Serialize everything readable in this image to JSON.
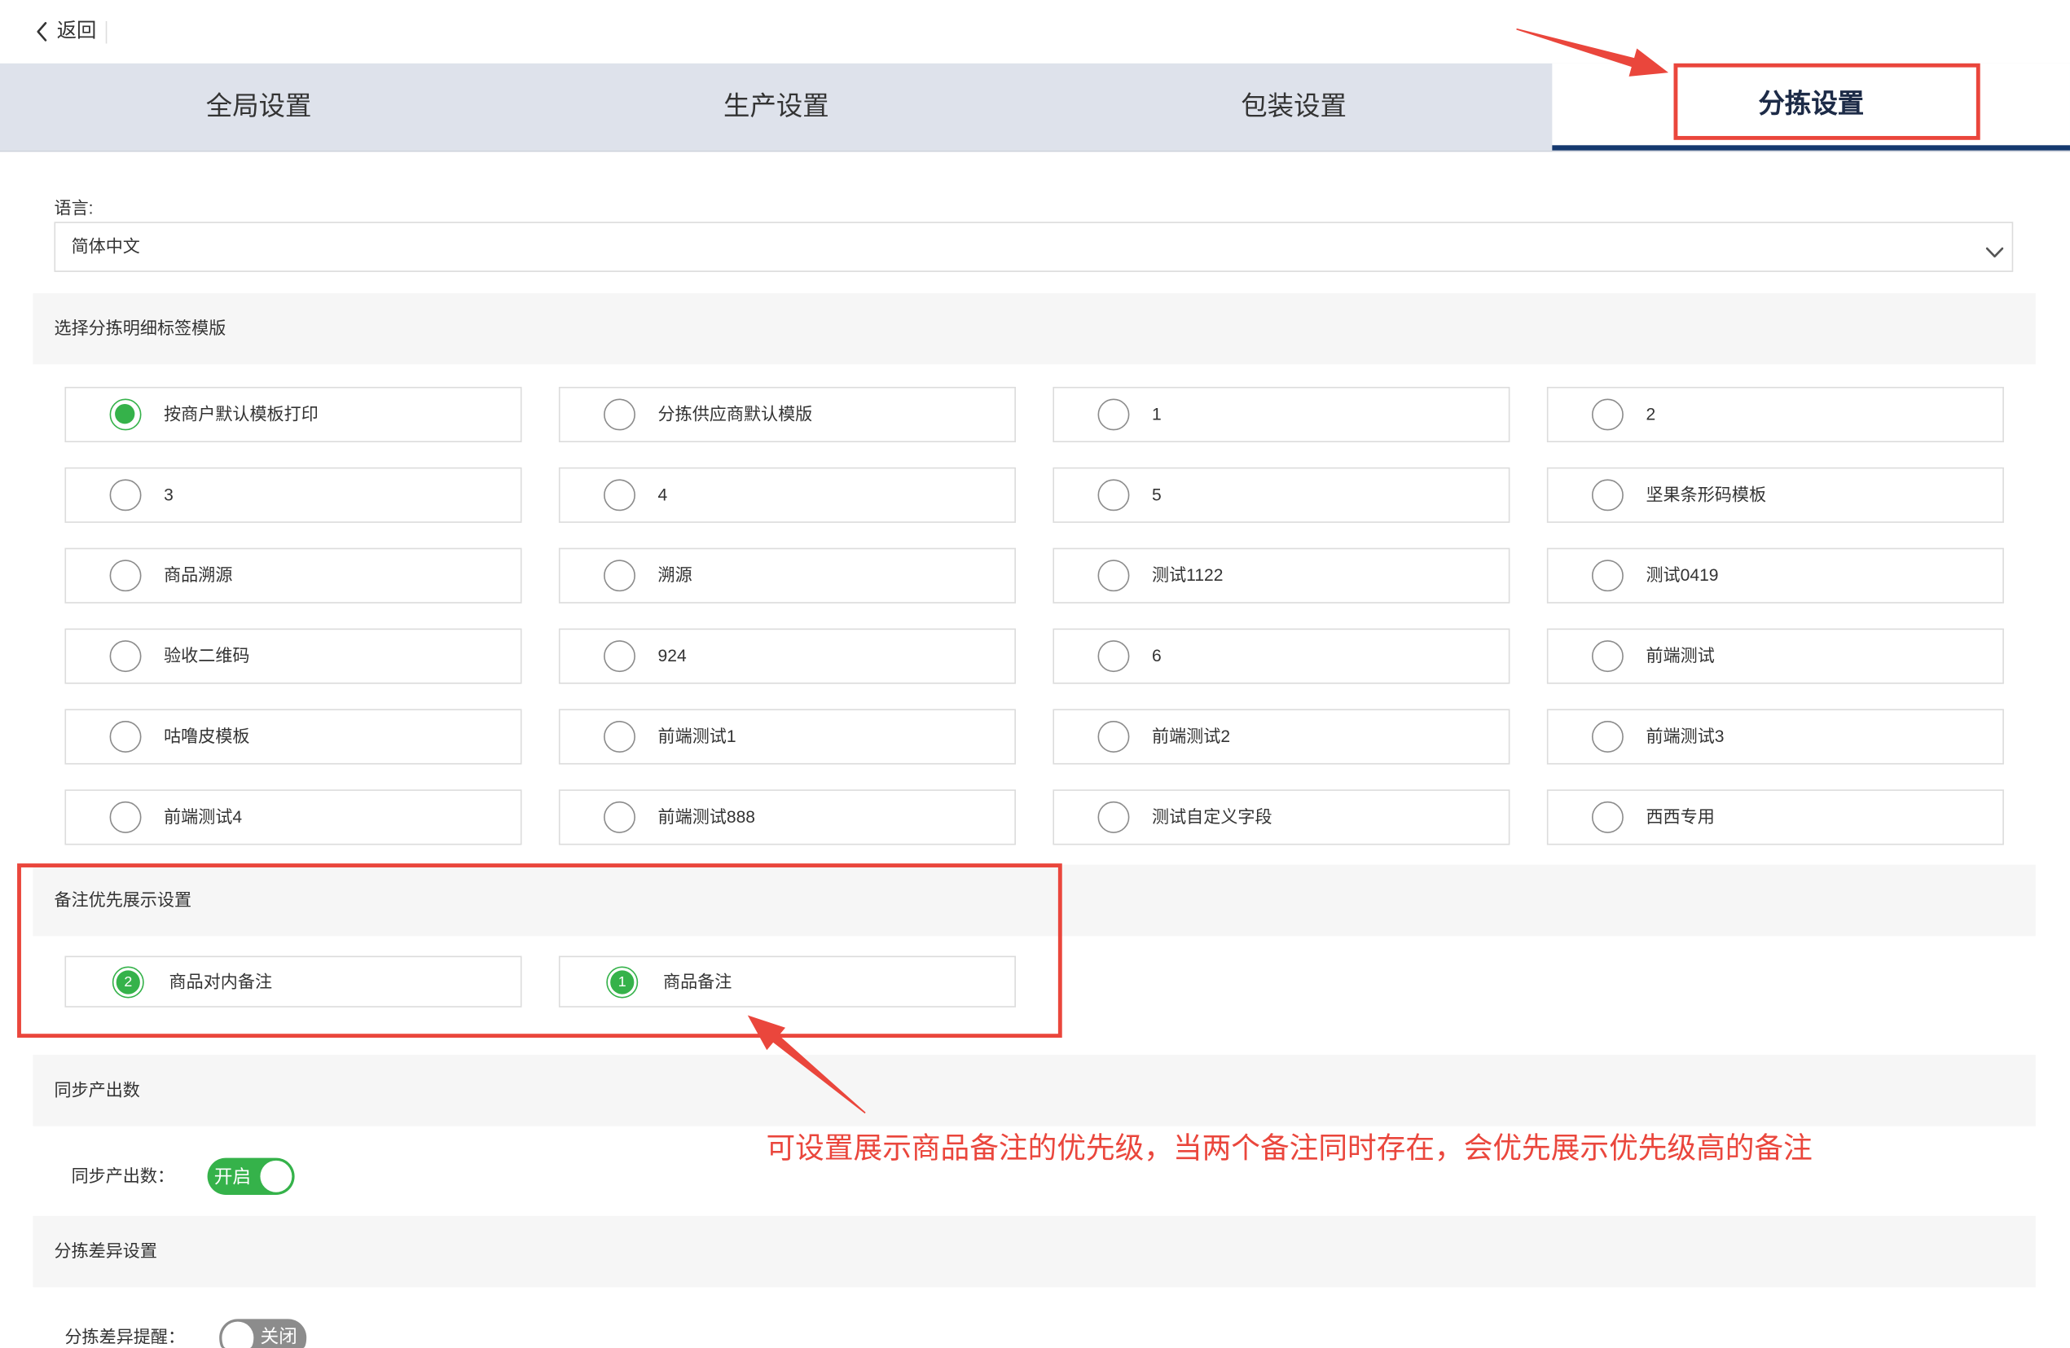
{
  "header": {
    "back_label": "返回"
  },
  "tabs": [
    {
      "label": "全局设置",
      "active": false
    },
    {
      "label": "生产设置",
      "active": false
    },
    {
      "label": "包装设置",
      "active": false
    },
    {
      "label": "分拣设置",
      "active": true
    }
  ],
  "language": {
    "label": "语言:",
    "value": "简体中文"
  },
  "template_section": {
    "title": "选择分拣明细标签模版",
    "selected_index": 0,
    "options": [
      "按商户默认模板打印",
      "分拣供应商默认模版",
      "1",
      "2",
      "3",
      "4",
      "5",
      "坚果条形码模板",
      "商品溯源",
      "溯源",
      "测试1122",
      "测试0419",
      "验收二维码",
      "924",
      "6",
      "前端测试",
      "咕噜皮模板",
      "前端测试1",
      "前端测试2",
      "前端测试3",
      "前端测试4",
      "前端测试888",
      "测试自定义字段",
      "西西专用"
    ]
  },
  "remark_section": {
    "title": "备注优先展示设置",
    "items": [
      {
        "label": "商品对内备注",
        "priority": "2"
      },
      {
        "label": "商品备注",
        "priority": "1"
      }
    ]
  },
  "sync_section": {
    "title": "同步产出数",
    "field_label": "同步产出数：",
    "toggle_label": "开启",
    "enabled": true
  },
  "diff_section": {
    "title": "分拣差异设置",
    "field_label": "分拣差异提醒：",
    "toggle_label": "关闭",
    "enabled": false
  },
  "annotation": {
    "text": "可设置展示商品备注的优先级，当两个备注同时存在，会优先展示优先级高的备注"
  },
  "icons": {
    "back": "chevron-left-icon",
    "language_select": "chevron-down-icon"
  },
  "colors": {
    "accent_green": "#35b24a",
    "annotation_red": "#ea463c",
    "tab_bar_bg": "#dee2eb",
    "active_tab_underline": "#15396f",
    "section_bg": "#f6f6f6",
    "toggle_off": "#8c8c8c"
  }
}
